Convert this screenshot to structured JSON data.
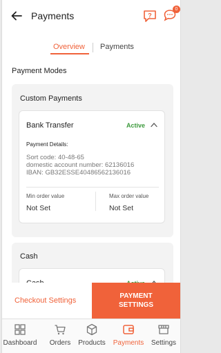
{
  "header": {
    "title": "Payments",
    "notification_count": "0"
  },
  "tabs": [
    {
      "label": "Overview",
      "active": true
    },
    {
      "label": "Payments",
      "active": false
    }
  ],
  "section_title": "Payment Modes",
  "custom_payments": {
    "title": "Custom Payments",
    "card": {
      "name": "Bank Transfer",
      "status": "Active",
      "details_label": "Payment Details:",
      "details_text": "Sort code: 40-48-65\ndomestic account number: 62136016\nIBAN: GB32ESSE40486562136016",
      "min_label": "Min order value",
      "min_value": "Not Set",
      "max_label": "Max order value",
      "max_value": "Not Set"
    }
  },
  "cash": {
    "title": "Cash",
    "card": {
      "name": "Cash",
      "status": "Active"
    }
  },
  "actions": {
    "checkout_settings": "Checkout Settings",
    "payment_settings": "PAYMENT SETTINGS"
  },
  "nav": [
    {
      "label": "Dashboard",
      "icon": "dashboard-icon",
      "active": false
    },
    {
      "label": "Orders",
      "icon": "cart-icon",
      "active": false
    },
    {
      "label": "Products",
      "icon": "box-icon",
      "active": false
    },
    {
      "label": "Payments",
      "icon": "wallet-icon",
      "active": true
    },
    {
      "label": "Settings",
      "icon": "store-icon",
      "active": false
    }
  ],
  "colors": {
    "accent": "#f0623a",
    "active_status": "#3d9a3d"
  }
}
